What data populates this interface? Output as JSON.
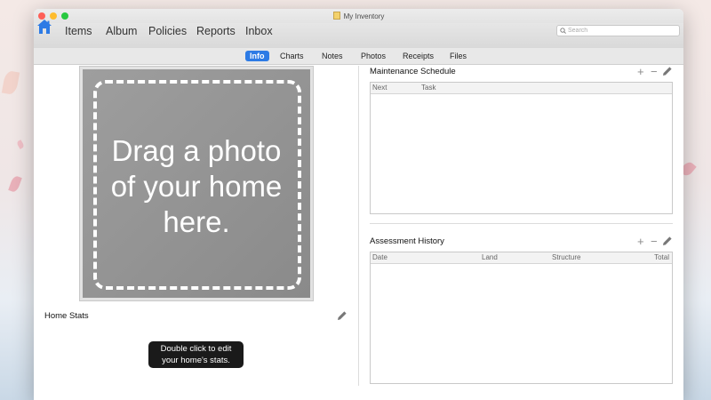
{
  "window": {
    "title": "My Inventory"
  },
  "toolbar": {
    "nav": [
      "Items",
      "Album",
      "Policies",
      "Reports",
      "Inbox"
    ],
    "search_placeholder": "Search",
    "search_value": ""
  },
  "tabs": [
    "Info",
    "Charts",
    "Notes",
    "Photos",
    "Receipts",
    "Files"
  ],
  "active_tab": "Info",
  "photo": {
    "line1": "Drag a photo",
    "line2": "of your home",
    "line3": "here."
  },
  "home_stats": {
    "label": "Home Stats",
    "tooltip_line1": "Double click to edit",
    "tooltip_line2": "your home's stats."
  },
  "maintenance": {
    "title": "Maintenance Schedule",
    "columns": [
      "Next",
      "Task"
    ]
  },
  "assessment": {
    "title": "Assessment History",
    "columns": [
      "Date",
      "Land",
      "Structure",
      "Total"
    ]
  },
  "controls": {
    "add": "+",
    "remove": "−"
  },
  "colors": {
    "accent": "#2d7be5",
    "close": "#fe5f57",
    "minimize": "#febc2e",
    "zoom": "#28c840"
  },
  "icons": {
    "home": "home-icon",
    "search": "search-icon",
    "edit": "pencil-icon"
  }
}
